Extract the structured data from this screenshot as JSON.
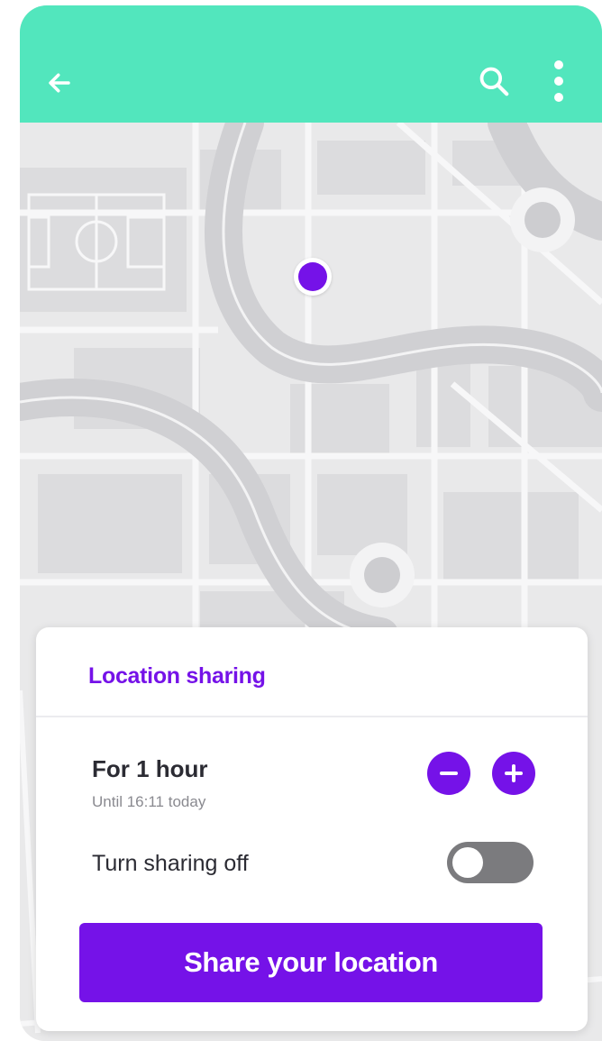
{
  "colors": {
    "app_bar": "#52e6bd",
    "accent": "#7512e8",
    "map_background": "#e9e9ea",
    "toggle_off": "#7b7b7e"
  },
  "app_bar": {
    "back_icon": "arrow-left-icon",
    "search_icon": "search-icon",
    "menu_icon": "more-vertical-icon"
  },
  "map": {
    "marker_icon": "location-dot-icon"
  },
  "sheet": {
    "title": "Location sharing",
    "duration": {
      "label": "For 1 hour",
      "until": "Until 16:11 today",
      "decrease_icon": "minus-circle-icon",
      "increase_icon": "plus-circle-icon"
    },
    "toggle": {
      "label": "Turn sharing off",
      "on": false
    },
    "primary_button": "Share your location"
  }
}
